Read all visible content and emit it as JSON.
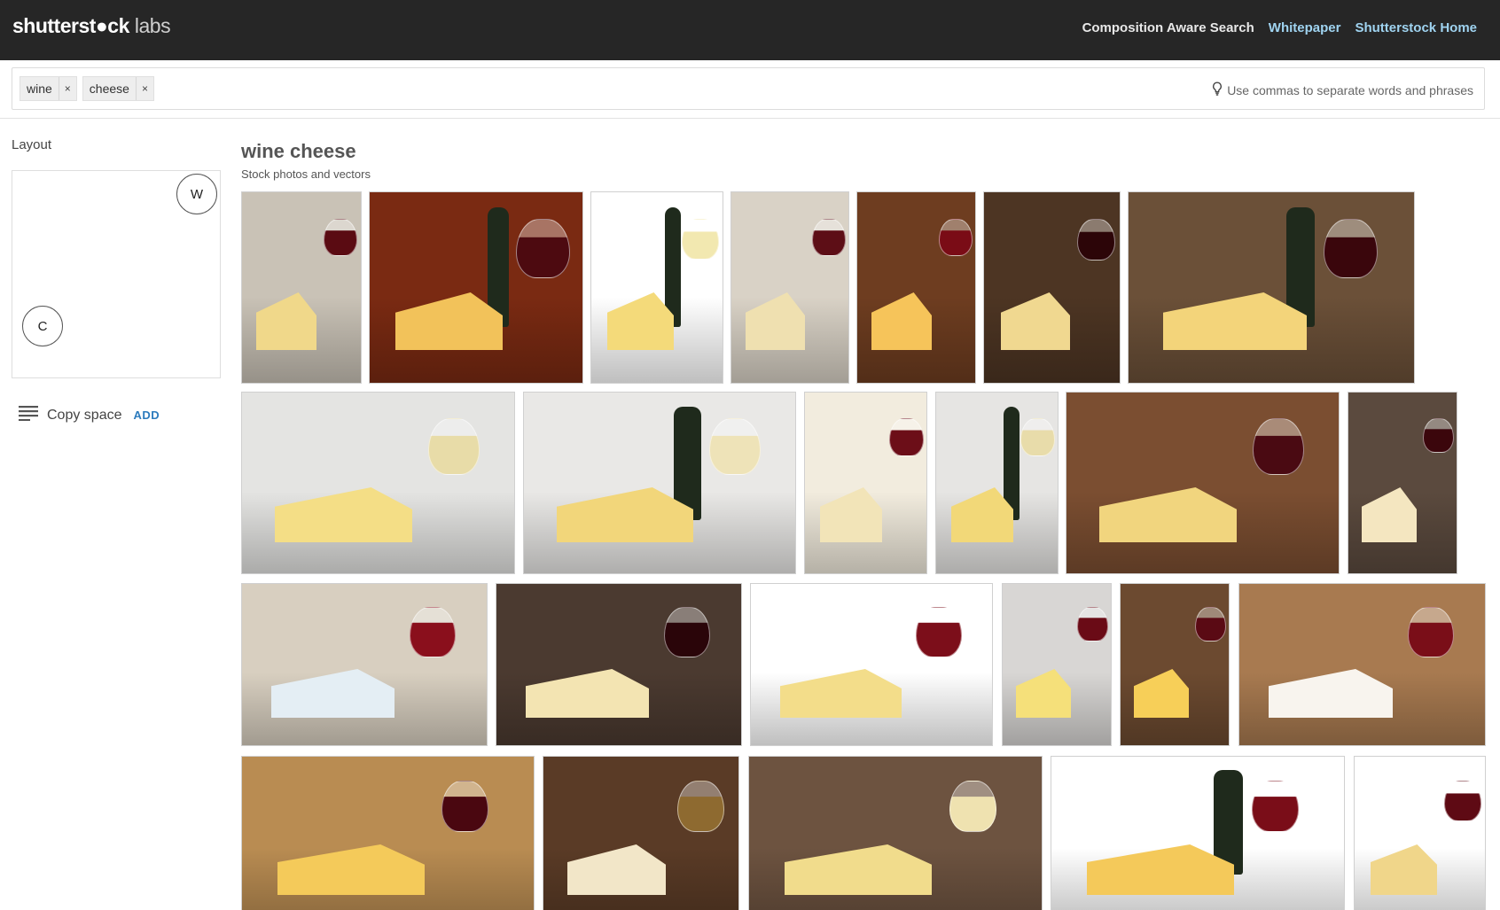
{
  "header": {
    "brand": "shutterst●ck",
    "brand_suffix": "labs",
    "nav": [
      {
        "label": "Composition Aware Search",
        "style": "plain"
      },
      {
        "label": "Whitepaper",
        "style": "accent"
      },
      {
        "label": "Shutterstock Home",
        "style": "accent"
      }
    ]
  },
  "search": {
    "tags": [
      "wine",
      "cheese"
    ],
    "remove_glyph": "×",
    "hint": "Use commas to separate words and phrases",
    "hint_icon": "lightbulb-icon"
  },
  "sidebar": {
    "title": "Layout",
    "circles": [
      "W",
      "C"
    ],
    "copy_space_label": "Copy space",
    "copy_space_action": "ADD",
    "copy_space_icon": "text-lines-icon"
  },
  "results": {
    "title": "wine cheese",
    "subtitle": "Stock photos and vectors",
    "tiles": [
      {
        "bg": "#c9c2b6",
        "wine": "#5a0b12",
        "cheese": "#f0d88a",
        "bottle": false
      },
      {
        "bg": "#7a2a12",
        "wine": "#4d0a10",
        "cheese": "#f2c25a",
        "bottle": true
      },
      {
        "bg": "#ffffff",
        "wine": "#f2e8b0",
        "cheese": "#f4da7a",
        "bottle": true
      },
      {
        "bg": "#d9d2c6",
        "wine": "#5d0e16",
        "cheese": "#efe0b0",
        "bottle": false
      },
      {
        "bg": "#6e3d20",
        "wine": "#7a0c16",
        "cheese": "#f6c45a",
        "bottle": false
      },
      {
        "bg": "#4d3523",
        "wine": "#2c0508",
        "cheese": "#f0d890",
        "bottle": false
      },
      {
        "bg": "#6b5038",
        "wine": "#3a060c",
        "cheese": "#f3d47a",
        "bottle": true
      },
      {
        "bg": "#e4e4e2",
        "wine": "#e8dca8",
        "cheese": "#f4de86",
        "bottle": false
      },
      {
        "bg": "#e9e8e6",
        "wine": "#eee3b8",
        "cheese": "#f2d67a",
        "bottle": true
      },
      {
        "bg": "#f2ecde",
        "wine": "#6c0e18",
        "cheese": "#f2e4b8",
        "bottle": false
      },
      {
        "bg": "#e6e5e3",
        "wine": "#e8dcaa",
        "cheese": "#f2d878",
        "bottle": true
      },
      {
        "bg": "#7b4e31",
        "wine": "#4a0a12",
        "cheese": "#f1d57e",
        "bottle": false
      },
      {
        "bg": "#5b4a3e",
        "wine": "#3b060c",
        "cheese": "#f4e6c0",
        "bottle": false
      },
      {
        "bg": "#d8cfc0",
        "wine": "#8a0f1c",
        "cheese": "#e4eef4",
        "bottle": false
      },
      {
        "bg": "#4b3a30",
        "wine": "#2a0509",
        "cheese": "#f3e4b2",
        "bottle": false
      },
      {
        "bg": "#ffffff",
        "wine": "#7c0e1a",
        "cheese": "#f3dd8a",
        "bottle": false
      },
      {
        "bg": "#d8d6d4",
        "wine": "#6a0b16",
        "cheese": "#f5e07a",
        "bottle": false
      },
      {
        "bg": "#6c4a30",
        "wine": "#5a0a14",
        "cheese": "#f7cf58",
        "bottle": false
      },
      {
        "bg": "#a87a50",
        "wine": "#7a0e18",
        "cheese": "#f8f4ee",
        "bottle": false
      },
      {
        "bg": "#b98c52",
        "wine": "#4a0710",
        "cheese": "#f4ca5a",
        "bottle": false
      },
      {
        "bg": "#5a3b26",
        "wine": "#8e6a30",
        "cheese": "#f2e6c8",
        "bottle": false
      },
      {
        "bg": "#6d5340",
        "wine": "#efe2b0",
        "cheese": "#f1dc8c",
        "bottle": false
      },
      {
        "bg": "#ffffff",
        "wine": "#7a0d18",
        "cheese": "#f4c95a",
        "bottle": true
      },
      {
        "bg": "#ffffff",
        "wine": "#5e0a14",
        "cheese": "#f0d68a",
        "bottle": false
      }
    ]
  }
}
